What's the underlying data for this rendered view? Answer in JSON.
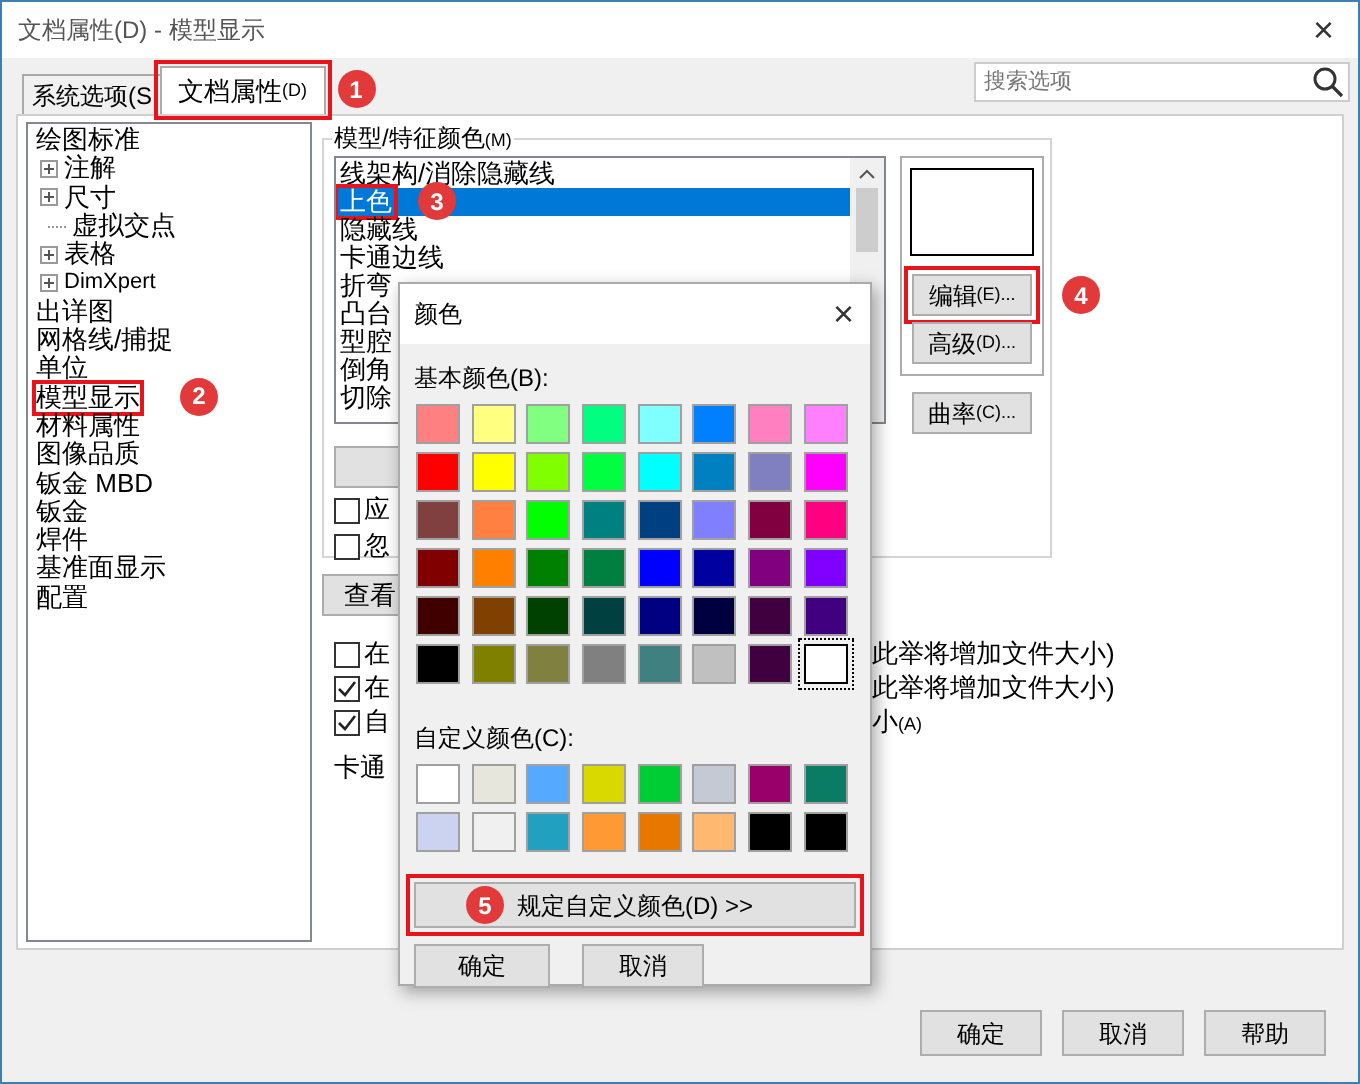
{
  "window": {
    "title": "文档属性(D) - 模型显示",
    "close": "×"
  },
  "tabs": [
    {
      "label": "系统选项(S",
      "selected": false
    },
    {
      "label": "文档属性",
      "mnemonic": "(D)",
      "selected": true,
      "callout": "1"
    }
  ],
  "search": {
    "placeholder": "搜索选项"
  },
  "tree": [
    {
      "label": "绘图标准",
      "kind": "leaf",
      "children": [
        {
          "label": "注解",
          "kind": "branch",
          "expanded": false
        },
        {
          "label": "尺寸",
          "kind": "branch",
          "expanded": false
        },
        {
          "label": "虚拟交点",
          "kind": "leaf"
        },
        {
          "label": "表格",
          "kind": "branch",
          "expanded": false
        },
        {
          "label": "DimXpert",
          "kind": "branch",
          "expanded": false
        }
      ]
    },
    {
      "label": "出详图",
      "kind": "leaf"
    },
    {
      "label": "网格线/捕捉",
      "kind": "leaf"
    },
    {
      "label": "单位",
      "kind": "leaf"
    },
    {
      "label": "模型显示",
      "kind": "leaf",
      "callout": "2"
    },
    {
      "label": "材料属性",
      "kind": "leaf"
    },
    {
      "label": "图像品质",
      "kind": "leaf"
    },
    {
      "label": "钣金 MBD",
      "kind": "leaf"
    },
    {
      "label": "钣金",
      "kind": "leaf"
    },
    {
      "label": "焊件",
      "kind": "leaf"
    },
    {
      "label": "基准面显示",
      "kind": "leaf"
    },
    {
      "label": "配置",
      "kind": "leaf"
    }
  ],
  "model_colors": {
    "label": "模型/特征颜色",
    "mnemonic": "(M)",
    "items": [
      {
        "label": "线架构/消除隐藏线",
        "selected": false
      },
      {
        "label": "上色",
        "selected": true,
        "callout": "3"
      },
      {
        "label": "隐藏线",
        "selected": false
      },
      {
        "label": "卡通边线",
        "selected": false
      },
      {
        "label": "折弯",
        "selected": false
      },
      {
        "label": "凸台",
        "selected": false
      },
      {
        "label": "型腔",
        "selected": false
      },
      {
        "label": "倒角",
        "selected": false
      },
      {
        "label": "切除",
        "selected": false
      }
    ],
    "buttons": [
      {
        "label": "编辑",
        "mnemonic": "(E)...",
        "callout": "4"
      },
      {
        "label": "高级",
        "mnemonic": "(D)..."
      }
    ],
    "curvature_button": {
      "label": "曲率",
      "mnemonic": "(C)..."
    },
    "options": [
      {
        "label": "应",
        "checked": false
      },
      {
        "label": "忽",
        "checked": false
      }
    ]
  },
  "view_button": {
    "label": "查看"
  },
  "options": [
    {
      "label": "在",
      "tail": "此举将增加文件大小)",
      "checked": false
    },
    {
      "label": "在",
      "tail": "此举将增加文件大小)",
      "checked": true
    },
    {
      "label": "自",
      "tail": "小",
      "tail_mnemonic": "(A)",
      "checked": true
    }
  ],
  "cartoon_label": "卡通",
  "footer_buttons": [
    "确定",
    "取消",
    "帮助"
  ],
  "color_dialog": {
    "title": "颜色",
    "close": "×",
    "basic_label": "基本颜色(B):",
    "basic_colors": [
      {
        "color": "#ff8080",
        "selected": false
      },
      {
        "color": "#ffff80",
        "selected": false
      },
      {
        "color": "#80ff80",
        "selected": false
      },
      {
        "color": "#00ff80",
        "selected": false
      },
      {
        "color": "#80ffff",
        "selected": false
      },
      {
        "color": "#0080ff",
        "selected": false
      },
      {
        "color": "#ff80c0",
        "selected": false
      },
      {
        "color": "#ff80ff",
        "selected": false
      },
      {
        "color": "#ff0000",
        "selected": false
      },
      {
        "color": "#ffff00",
        "selected": false
      },
      {
        "color": "#80ff00",
        "selected": false
      },
      {
        "color": "#00ff40",
        "selected": false
      },
      {
        "color": "#00ffff",
        "selected": false
      },
      {
        "color": "#0080c0",
        "selected": false
      },
      {
        "color": "#8080c0",
        "selected": false
      },
      {
        "color": "#ff00ff",
        "selected": false
      },
      {
        "color": "#804040",
        "selected": false
      },
      {
        "color": "#ff8040",
        "selected": false
      },
      {
        "color": "#00ff00",
        "selected": false
      },
      {
        "color": "#008080",
        "selected": false
      },
      {
        "color": "#004080",
        "selected": false
      },
      {
        "color": "#8080ff",
        "selected": false
      },
      {
        "color": "#800040",
        "selected": false
      },
      {
        "color": "#ff0080",
        "selected": false
      },
      {
        "color": "#800000",
        "selected": false
      },
      {
        "color": "#ff8000",
        "selected": false
      },
      {
        "color": "#008000",
        "selected": false
      },
      {
        "color": "#008040",
        "selected": false
      },
      {
        "color": "#0000ff",
        "selected": false
      },
      {
        "color": "#0000a0",
        "selected": false
      },
      {
        "color": "#800080",
        "selected": false
      },
      {
        "color": "#8000ff",
        "selected": false
      },
      {
        "color": "#400000",
        "selected": false
      },
      {
        "color": "#804000",
        "selected": false
      },
      {
        "color": "#004000",
        "selected": false
      },
      {
        "color": "#004040",
        "selected": false
      },
      {
        "color": "#000080",
        "selected": false
      },
      {
        "color": "#000040",
        "selected": false
      },
      {
        "color": "#400040",
        "selected": false
      },
      {
        "color": "#400080",
        "selected": false
      },
      {
        "color": "#000000",
        "selected": false
      },
      {
        "color": "#808000",
        "selected": false
      },
      {
        "color": "#808040",
        "selected": false
      },
      {
        "color": "#808080",
        "selected": false
      },
      {
        "color": "#408080",
        "selected": false
      },
      {
        "color": "#c0c0c0",
        "selected": false
      },
      {
        "color": "#400040",
        "selected": false
      },
      {
        "color": "#ffffff",
        "selected": true
      }
    ],
    "custom_label": "自定义颜色(C):",
    "custom_colors": [
      {
        "color": "#ffffff"
      },
      {
        "color": "#e6e6dc"
      },
      {
        "color": "#55aaff"
      },
      {
        "color": "#d9d900"
      },
      {
        "color": "#00cc33"
      },
      {
        "color": "#c5c9d3"
      },
      {
        "color": "#99006a"
      },
      {
        "color": "#0a7c64"
      },
      {
        "color": "#cbd3f0"
      },
      {
        "color": "#f0f0f0"
      },
      {
        "color": "#22a0c0"
      },
      {
        "color": "#ff9933"
      },
      {
        "color": "#e87700"
      },
      {
        "color": "#ffb870"
      },
      {
        "color": "#000000"
      },
      {
        "color": "#000000"
      }
    ],
    "define_button": {
      "label": "规定自定义颜色(D) >>",
      "callout": "5"
    },
    "ok": "确定",
    "cancel": "取消"
  }
}
